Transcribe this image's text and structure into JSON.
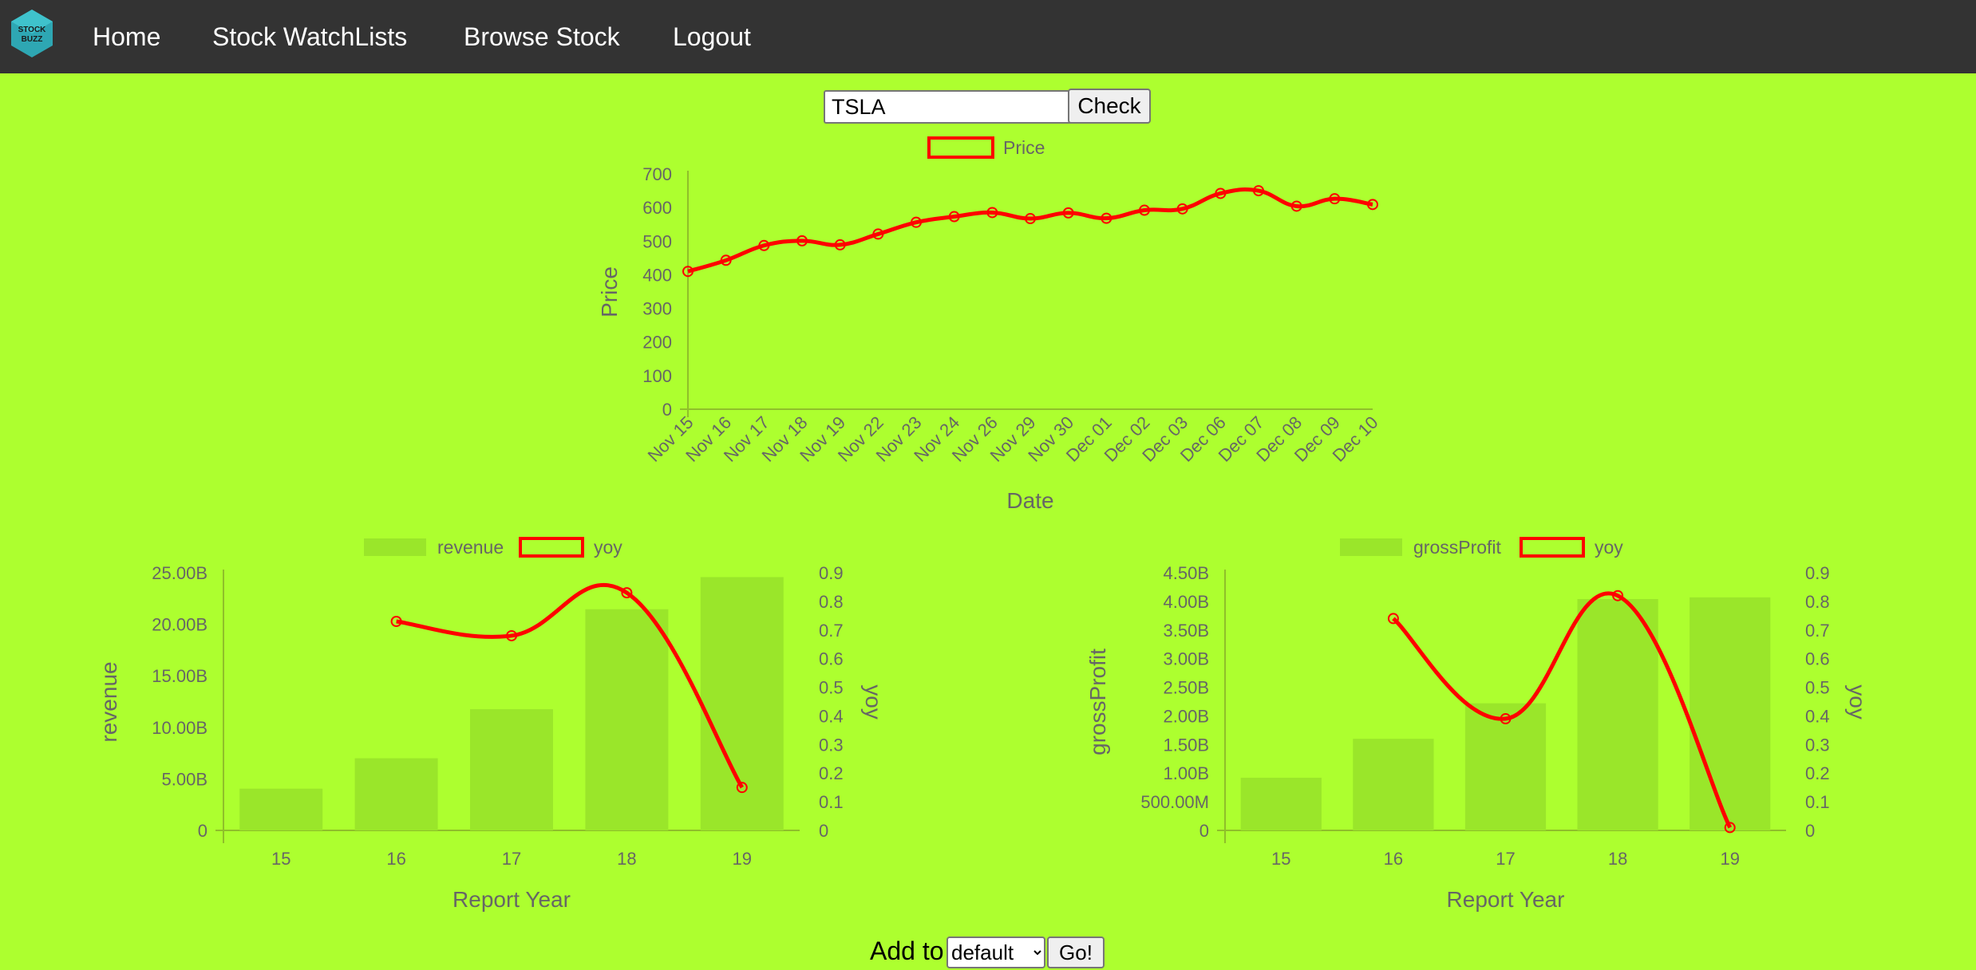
{
  "nav": {
    "logo_text": "STOCK BUZZ",
    "links": [
      "Home",
      "Stock WatchLists",
      "Browse Stock",
      "Logout"
    ]
  },
  "search": {
    "value": "TSLA",
    "button_label": "Check"
  },
  "colors": {
    "background": "#adff2f",
    "navbar": "#333333",
    "line": "#ff0000",
    "bar": "#9ae62a",
    "text": "#666666"
  },
  "chart_data": [
    {
      "type": "line",
      "series": [
        {
          "name": "Price",
          "values": [
            410,
            443,
            487,
            501,
            489,
            521,
            556,
            573,
            585,
            567,
            584,
            568,
            592,
            596,
            642,
            650,
            604,
            626,
            609
          ]
        }
      ],
      "x": [
        "Nov 15",
        "Nov 16",
        "Nov 17",
        "Nov 18",
        "Nov 19",
        "Nov 22",
        "Nov 23",
        "Nov 24",
        "Nov 26",
        "Nov 29",
        "Nov 30",
        "Dec 01",
        "Dec 02",
        "Dec 03",
        "Dec 06",
        "Dec 07",
        "Dec 08",
        "Dec 09",
        "Dec 10"
      ],
      "xlabel": "Date",
      "ylabel": "Price",
      "ylim": [
        0,
        700
      ],
      "yticks": [
        "0",
        "100",
        "200",
        "300",
        "400",
        "500",
        "600",
        "700"
      ],
      "legend": "top"
    },
    {
      "type": "bar",
      "categories": [
        "15",
        "16",
        "17",
        "18",
        "19"
      ],
      "series": [
        {
          "name": "revenue",
          "type": "bar",
          "values": [
            4.05,
            7.0,
            11.76,
            21.46,
            24.58
          ]
        },
        {
          "name": "yoy",
          "type": "line",
          "values": [
            null,
            0.73,
            0.68,
            0.83,
            0.15
          ]
        }
      ],
      "xlabel": "Report Year",
      "ylabel": "revenue",
      "y2label": "yoy",
      "ylim": [
        0,
        25
      ],
      "y2lim": [
        0,
        0.9
      ],
      "yticks": [
        "0",
        "5.00B",
        "10.00B",
        "15.00B",
        "20.00B",
        "25.00B"
      ],
      "y2ticks": [
        "0",
        "0.1",
        "0.2",
        "0.3",
        "0.4",
        "0.5",
        "0.6",
        "0.7",
        "0.8",
        "0.9"
      ],
      "legend": "top"
    },
    {
      "type": "bar",
      "categories": [
        "15",
        "16",
        "17",
        "18",
        "19"
      ],
      "series": [
        {
          "name": "grossProfit",
          "type": "bar",
          "values": [
            0.92,
            1.6,
            2.22,
            4.04,
            4.07
          ]
        },
        {
          "name": "yoy",
          "type": "line",
          "values": [
            null,
            0.74,
            0.39,
            0.82,
            0.01
          ]
        }
      ],
      "xlabel": "Report Year",
      "ylabel": "grossProfit",
      "y2label": "yoy",
      "ylim": [
        0,
        4.5
      ],
      "y2lim": [
        0,
        0.9
      ],
      "yticks": [
        "0",
        "500.00M",
        "1.00B",
        "1.50B",
        "2.00B",
        "2.50B",
        "3.00B",
        "3.50B",
        "4.00B",
        "4.50B"
      ],
      "y2ticks": [
        "0",
        "0.1",
        "0.2",
        "0.3",
        "0.4",
        "0.5",
        "0.6",
        "0.7",
        "0.8",
        "0.9"
      ],
      "legend": "top"
    }
  ],
  "watchlist": {
    "label": "Add to",
    "selected": "default",
    "button_label": "Go!"
  }
}
